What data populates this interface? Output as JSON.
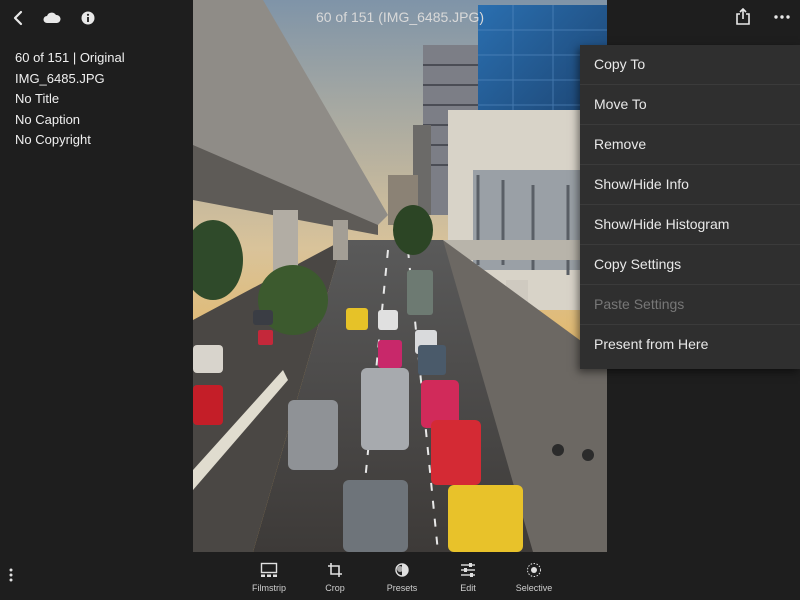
{
  "title": "60 of 151 (IMG_6485.JPG)",
  "info": {
    "line1": "60 of 151 | Original",
    "line2": "IMG_6485.JPG",
    "line3": "No Title",
    "line4": "No Caption",
    "line5": "No Copyright"
  },
  "menu": {
    "items": [
      {
        "label": "Copy To",
        "enabled": true
      },
      {
        "label": "Move To",
        "enabled": true
      },
      {
        "label": "Remove",
        "enabled": true
      },
      {
        "label": "Show/Hide Info",
        "enabled": true
      },
      {
        "label": "Show/Hide Histogram",
        "enabled": true
      },
      {
        "label": "Copy Settings",
        "enabled": true
      },
      {
        "label": "Paste Settings",
        "enabled": false
      },
      {
        "label": "Present from Here",
        "enabled": true
      }
    ]
  },
  "toolbar": {
    "filmstrip": "Filmstrip",
    "crop": "Crop",
    "presets": "Presets",
    "edit": "Edit",
    "selective": "Selective"
  },
  "icons": [
    "back-chevron-icon",
    "cloud-icon",
    "info-icon",
    "share-icon",
    "more-icon",
    "vertical-dots-icon"
  ],
  "colors": {
    "background": "#1e1e1e",
    "menu": "#2f2f2f",
    "text": "#e6e6e6",
    "disabled": "#777777"
  }
}
